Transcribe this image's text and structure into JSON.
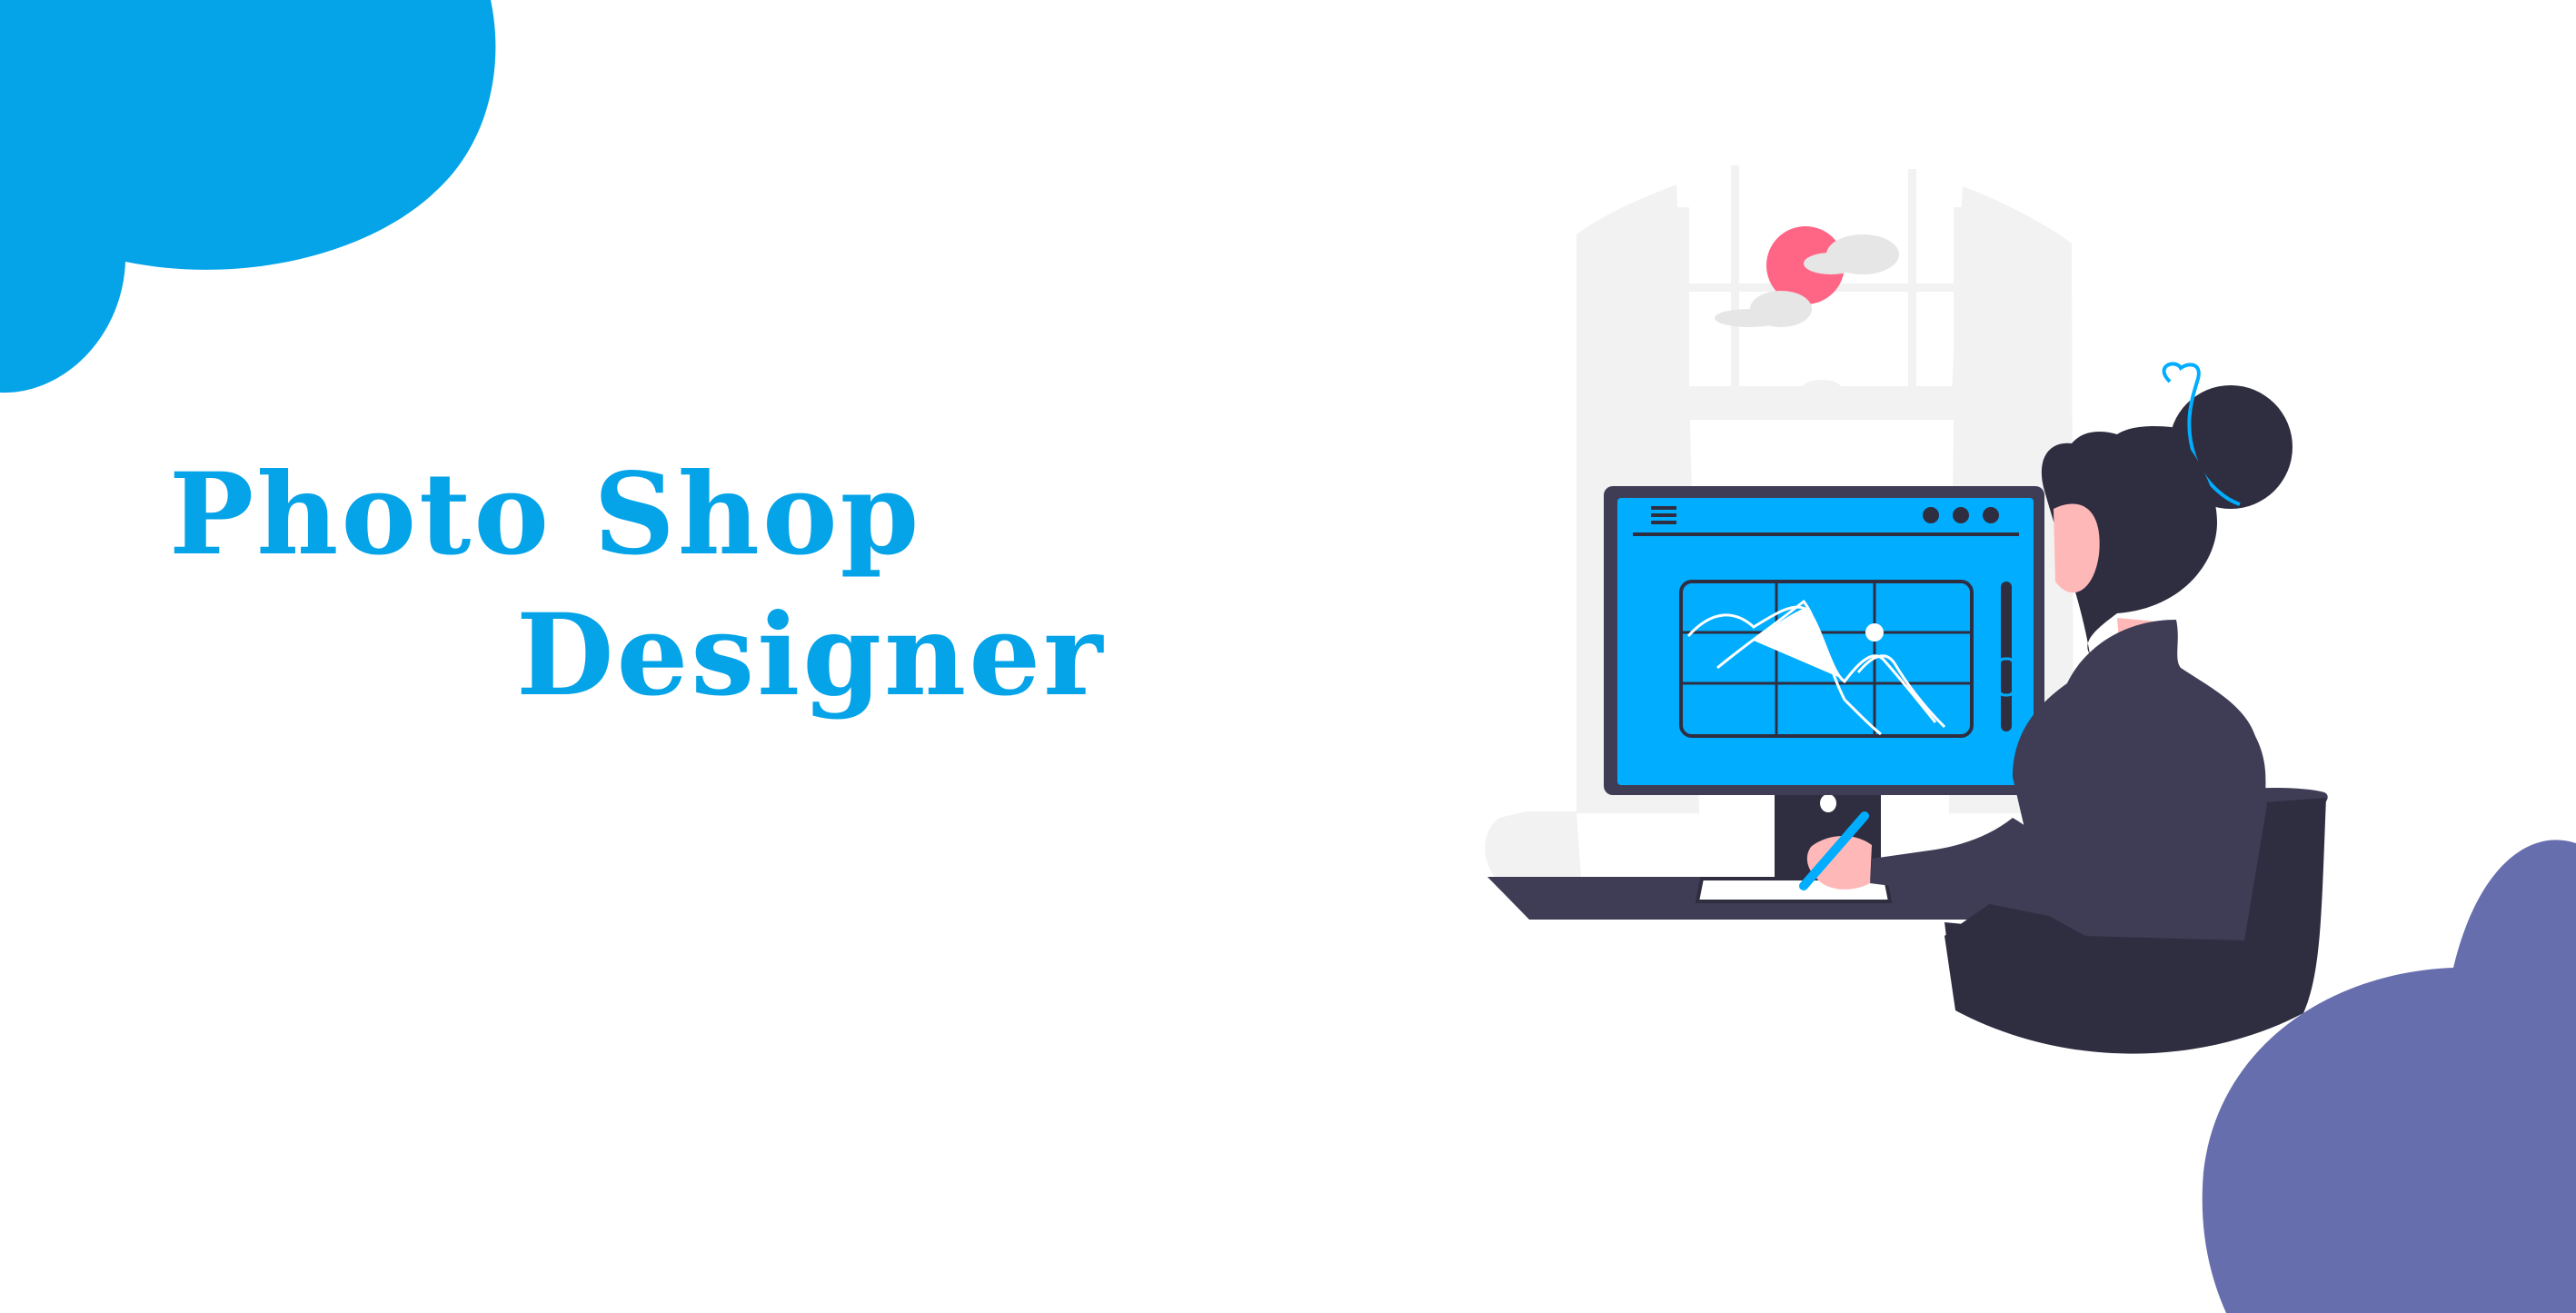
{
  "hero": {
    "title_line_1": "Photo Shop",
    "title_line_2": "Designer"
  },
  "colors": {
    "title": "#05a3e8",
    "blob_top_left": "#05a3e8",
    "blob_bottom_right": "#676eae",
    "screen": "#00adff",
    "dark": "#2f2e41",
    "sun": "#ff6584",
    "skin": "#ffb8b8"
  },
  "icons": {
    "menu": "hamburger-menu-icon",
    "window_controls": "three-dots-icon"
  }
}
